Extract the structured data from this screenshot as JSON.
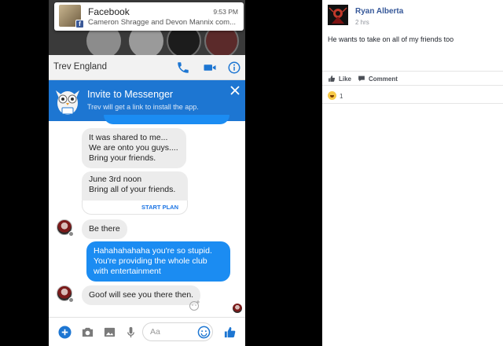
{
  "notification": {
    "app": "Facebook",
    "time": "9:53 PM",
    "body": "Cameron Shragge and Devon Mannix com..."
  },
  "chat": {
    "contact_name": "Trev England",
    "icons": [
      "phone-icon",
      "video-camera-icon",
      "info-icon"
    ]
  },
  "invite_banner": {
    "title": "Invite to Messenger",
    "subtitle": "Trev will get a link to install the app."
  },
  "messages": {
    "msg1": [
      "It was shared to me...",
      "We are onto you guys....",
      "Bring your friends."
    ],
    "plan_card": {
      "lines": [
        "June 3rd noon",
        "Bring all of your friends."
      ],
      "action": "START PLAN"
    },
    "msg2": "Be there",
    "msg3": [
      "Hahahahahaha you're so stupid.",
      "You're providing the whole club",
      "with entertainment"
    ],
    "msg4": "Goof will see you there then."
  },
  "composer": {
    "placeholder": "Aa",
    "icons": [
      "plus-icon",
      "camera-icon",
      "image-icon",
      "microphone-icon",
      "emoji-icon",
      "thumbs-up-icon"
    ]
  },
  "comment": {
    "author": "Ryan Alberta",
    "time": "2 hrs",
    "text": "He wants to take on all of my friends too",
    "like_label": "Like",
    "comment_label": "Comment",
    "reaction_count": "1"
  },
  "colors": {
    "messenger_blue": "#1d76d2",
    "outgoing_bubble": "#1b8cf2",
    "facebook_link": "#365899"
  }
}
